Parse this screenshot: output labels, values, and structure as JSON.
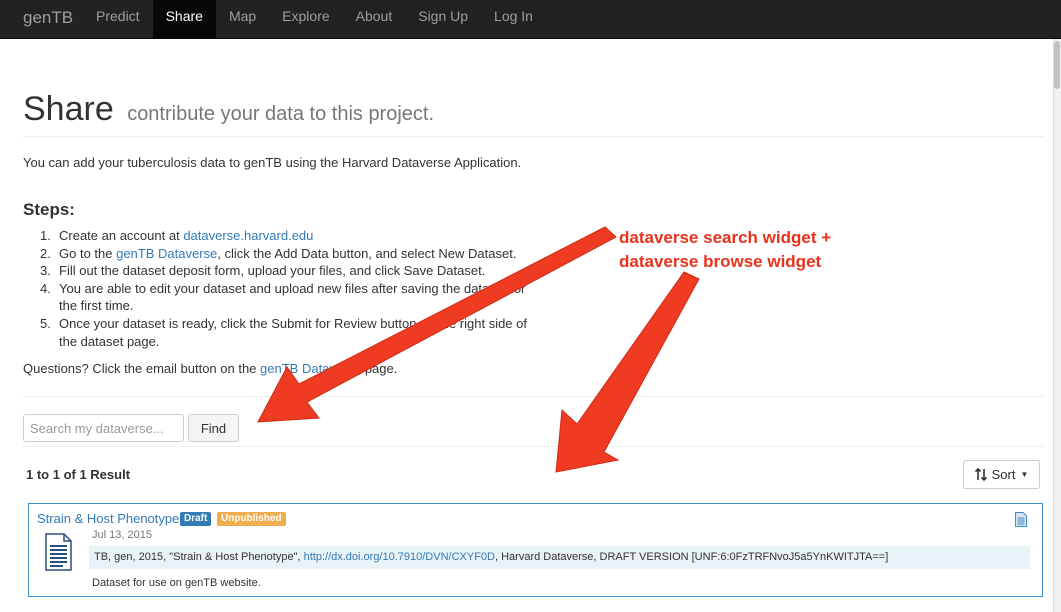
{
  "navbar": {
    "brand": "genTB",
    "items": [
      {
        "label": "Predict",
        "active": false
      },
      {
        "label": "Share",
        "active": true
      },
      {
        "label": "Map",
        "active": false
      },
      {
        "label": "Explore",
        "active": false
      },
      {
        "label": "About",
        "active": false
      },
      {
        "label": "Sign Up",
        "active": false
      },
      {
        "label": "Log In",
        "active": false
      }
    ]
  },
  "header": {
    "title": "Share",
    "subtitle": "contribute your data to this project."
  },
  "intro": "You can add your tuberculosis data to genTB using the Harvard Dataverse Application.",
  "steps": {
    "heading": "Steps:",
    "items": [
      {
        "num": "1.",
        "pre": "Create an account at ",
        "link": "dataverse.harvard.edu",
        "post": ""
      },
      {
        "num": "2.",
        "pre": "Go to the ",
        "link": "genTB Dataverse",
        "post": ", click the Add Data button, and select New Dataset."
      },
      {
        "num": "3.",
        "pre": "Fill out the dataset deposit form, upload your files, and click Save Dataset.",
        "link": "",
        "post": ""
      },
      {
        "num": "4.",
        "pre": "You are able to edit your dataset and upload new files after saving the dataset for the first time.",
        "link": "",
        "post": ""
      },
      {
        "num": "5.",
        "pre": "Once your dataset is ready, click the Submit for Review button on the right side of the dataset page.",
        "link": "",
        "post": ""
      }
    ]
  },
  "questions": {
    "pre": "Questions? Click the email button on the ",
    "link": "genTB Dataverse",
    "post": " page."
  },
  "search": {
    "placeholder": "Search my dataverse...",
    "button": "Find"
  },
  "results": {
    "count_text": "1 to 1 of 1 Result",
    "sort_label": "Sort"
  },
  "card": {
    "title": "Strain & Host Phenotype",
    "badge_draft": "Draft",
    "badge_unpublished": "Unpublished",
    "date": "Jul 13, 2015",
    "citation_pre": "TB, gen, 2015, \"Strain & Host Phenotype\", ",
    "citation_link": "http://dx.doi.org/10.7910/DVN/CXYF0D",
    "citation_post": ", Harvard Dataverse, DRAFT VERSION [UNF:6:0FzTRFNvoJ5a5YnKWITJTA==]",
    "description": "Dataset for use on genTB website."
  },
  "annotation": {
    "line1": "dataverse search widget +",
    "line2": "dataverse browse widget"
  },
  "colors": {
    "navbar_bg": "#222222",
    "link": "#337ab7",
    "annotation": "#e8321b",
    "draft_badge": "#337ab7",
    "unpublished_badge": "#f0ad4e"
  }
}
